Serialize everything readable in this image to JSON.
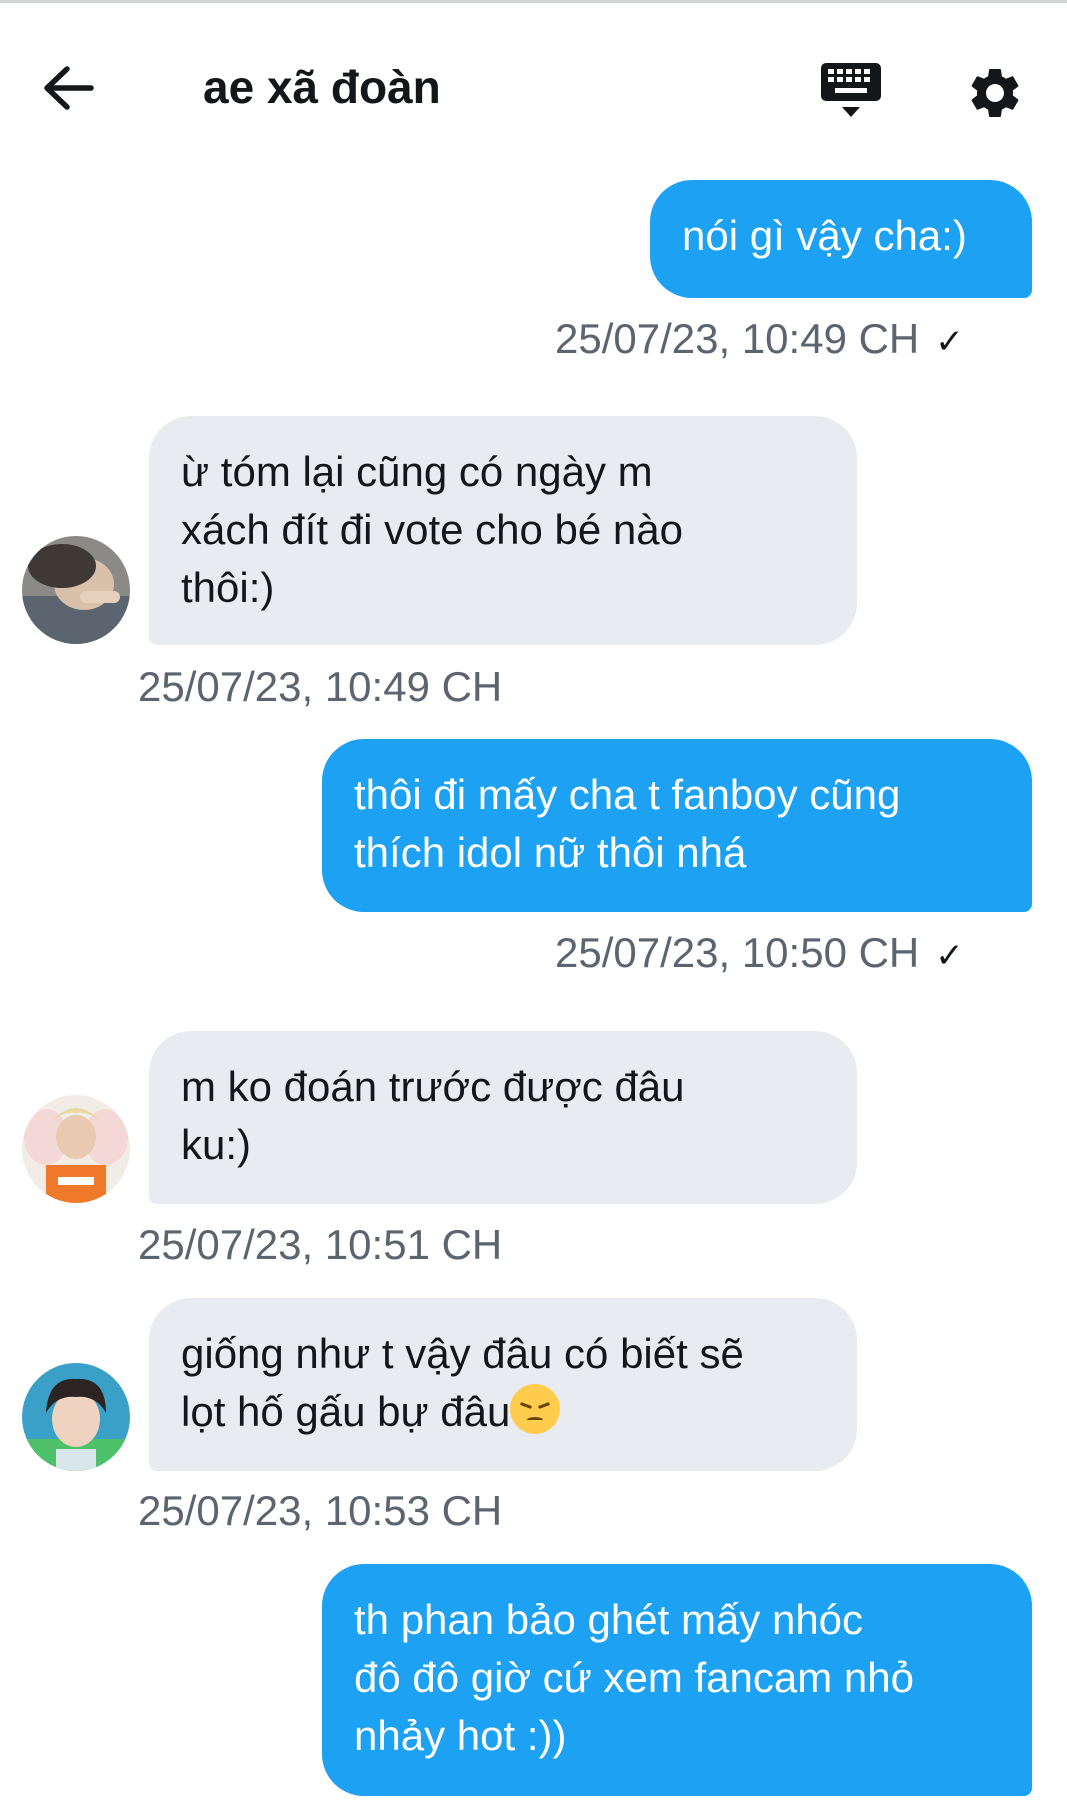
{
  "header": {
    "title": "ae xã đoàn",
    "back_icon": "arrow-left-icon",
    "keyboard_icon": "keyboard-icon",
    "settings_icon": "gear-icon"
  },
  "messages": [
    {
      "direction": "out",
      "text": "nói gì vậy cha:)",
      "timestamp": "25/07/23, 10:49 CH",
      "read_icon": "checkmark-icon"
    },
    {
      "direction": "in",
      "lines": [
        "ừ tóm lại cũng có ngày m",
        "xách đít đi vote cho bé nào",
        "thôi:)"
      ],
      "timestamp": "25/07/23, 10:49 CH"
    },
    {
      "direction": "out",
      "lines": [
        "thôi đi mấy cha t fanboy cũng",
        "thích idol nữ thôi nhá"
      ],
      "timestamp": "25/07/23, 10:50 CH",
      "read_icon": "checkmark-icon"
    },
    {
      "direction": "in",
      "lines": [
        "m ko đoán trước được đâu",
        "ku:)"
      ],
      "timestamp": "25/07/23, 10:51 CH"
    },
    {
      "direction": "in",
      "lines": [
        "giống như t vậy đâu có biết sẽ",
        "lọt hố gấu bự đâu"
      ],
      "emoji": "pensive-face-emoji",
      "timestamp": "25/07/23, 10:53 CH"
    },
    {
      "direction": "out",
      "lines": [
        "th phan bảo ghét mấy nhóc",
        "đô đô giờ cứ xem fancam nhỏ",
        "nhảy hot :))"
      ]
    }
  ],
  "colors": {
    "outgoing_bubble": "#1da1f2",
    "incoming_bubble": "#e8ecf0",
    "timestamp_text": "#5b6570"
  }
}
